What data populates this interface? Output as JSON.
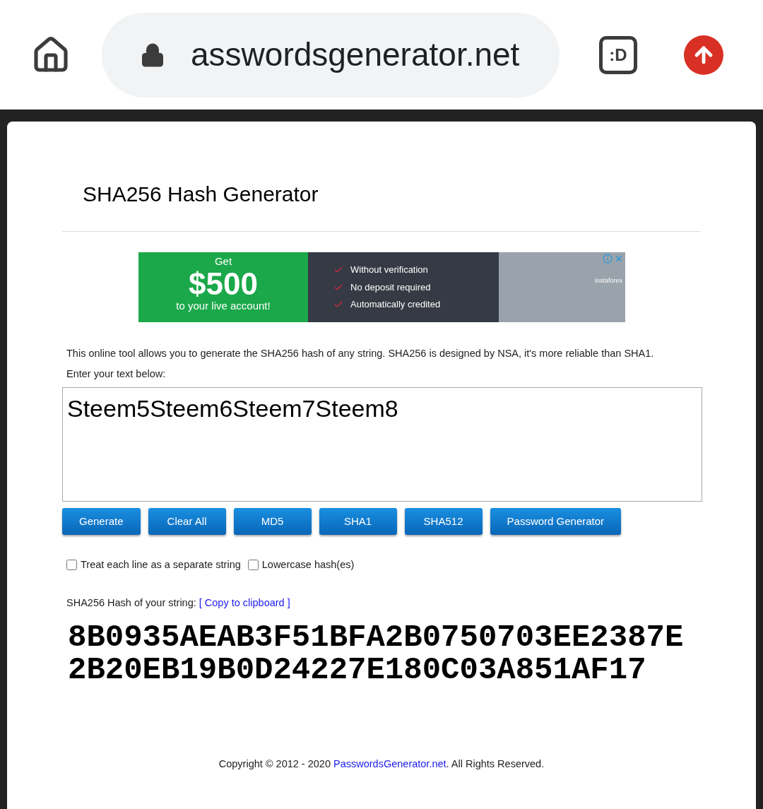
{
  "browser": {
    "url": "asswordsgenerator.net",
    "tab_icon_label": ":D"
  },
  "page": {
    "title": "SHA256 Hash Generator",
    "ad": {
      "get": "Get",
      "amount": "$500",
      "subline": "to your live account!",
      "features": [
        "Without verification",
        "No deposit required",
        "Automatically credited"
      ],
      "brand": "instaforex"
    },
    "description": "This online tool allows you to generate the SHA256 hash of any string. SHA256 is designed by NSA, it's more reliable than SHA1.",
    "input_label": "Enter your text below:",
    "input_value": "Steem5Steem6Steem7Steem8",
    "buttons": [
      "Generate",
      "Clear All",
      "MD5",
      "SHA1",
      "SHA512",
      "Password Generator"
    ],
    "options": [
      {
        "label": "Treat each line as a separate string",
        "checked": false
      },
      {
        "label": "Lowercase hash(es)",
        "checked": false
      }
    ],
    "result_label": "SHA256 Hash of your string:",
    "copy_link": "[ Copy to clipboard ]",
    "hash": "8B0935AEAB3F51BFA2B0750703EE2387E2B20EB19B0D24227E180C03A851AF17",
    "footer": {
      "before": "Copyright © 2012 - 2020 ",
      "link": "PasswordsGenerator.net",
      "after": ". All Rights Reserved."
    }
  }
}
